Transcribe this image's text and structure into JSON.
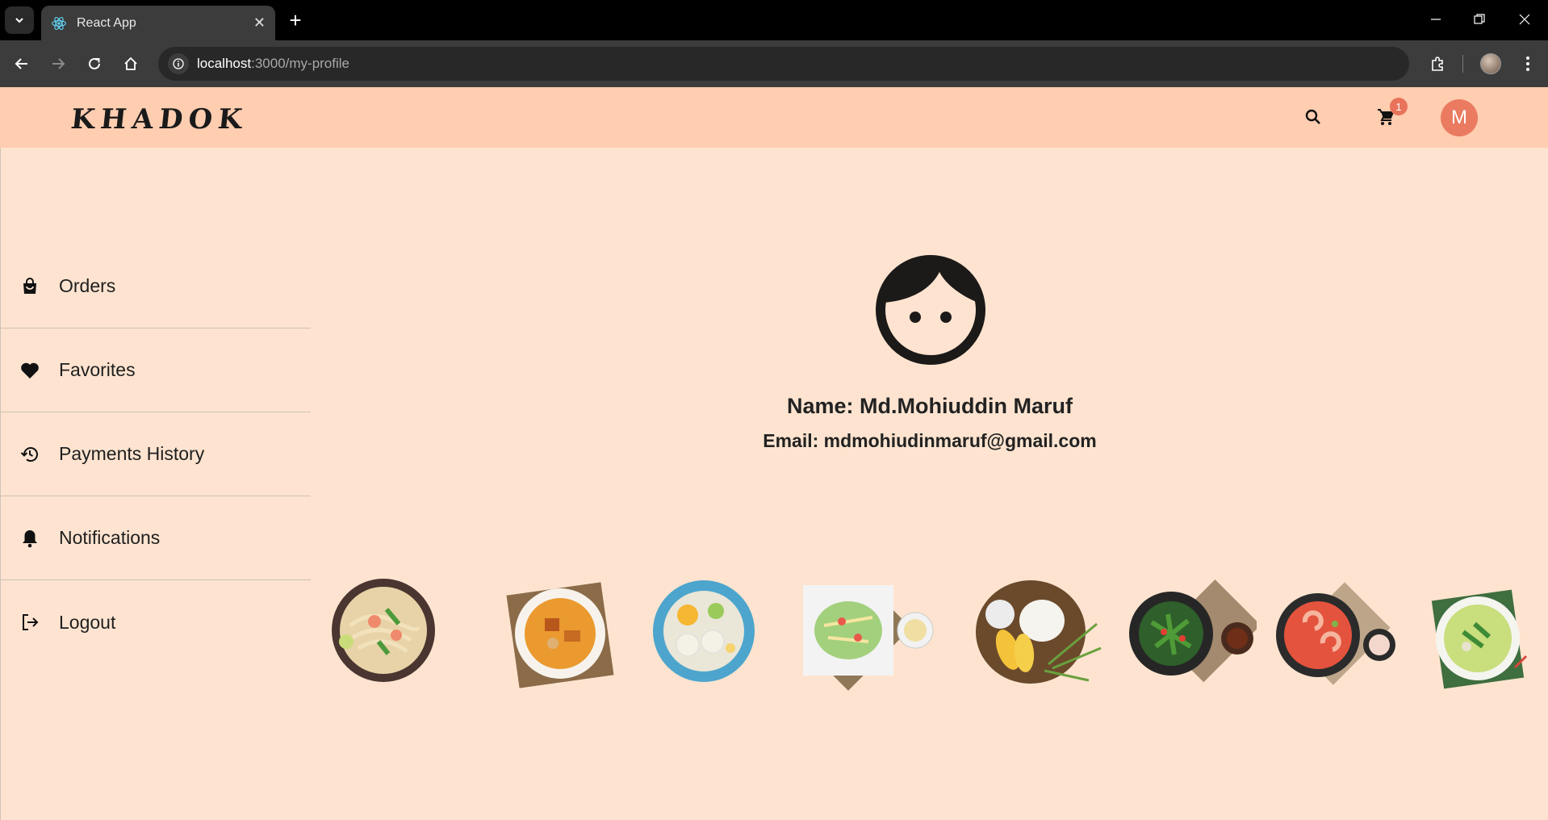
{
  "browser": {
    "tab_title": "React App",
    "url_host": "localhost",
    "url_path": ":3000/my-profile"
  },
  "header": {
    "logo": "KHADOK",
    "cart_count": "1",
    "avatar_initial": "M"
  },
  "sidebar": {
    "items": [
      {
        "label": "Orders",
        "icon": "shopping-bag-icon"
      },
      {
        "label": "Favorites",
        "icon": "heart-icon"
      },
      {
        "label": "Payments History",
        "icon": "history-icon"
      },
      {
        "label": "Notifications",
        "icon": "bell-icon"
      },
      {
        "label": "Logout",
        "icon": "logout-icon"
      }
    ]
  },
  "profile": {
    "name": "Name: Md.Mohiuddin Maruf",
    "email": "Email: mdmohiudinmaruf@gmail.com"
  },
  "colors": {
    "header_bg": "#ffcdb0",
    "page_bg": "#fee4d0",
    "accent": "#ea7b60"
  }
}
